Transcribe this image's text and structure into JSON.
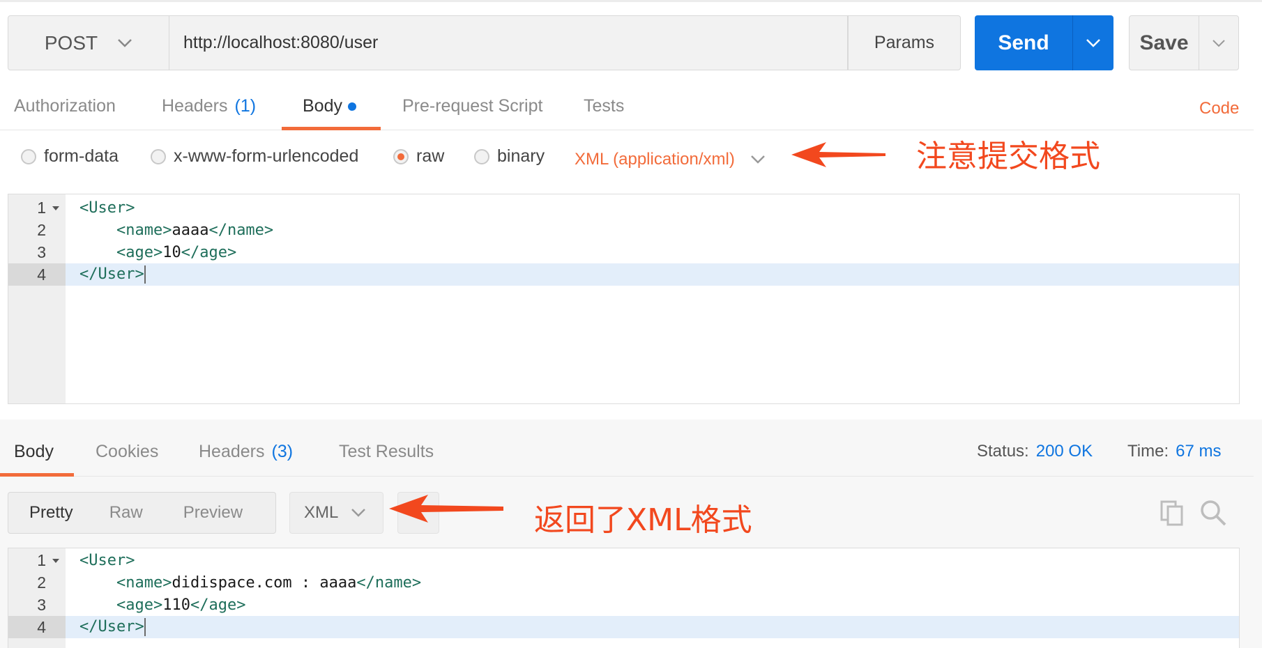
{
  "request": {
    "method": "POST",
    "url": "http://localhost:8080/user",
    "params_label": "Params",
    "send_label": "Send",
    "save_label": "Save"
  },
  "request_tabs": {
    "authorization": "Authorization",
    "headers": "Headers",
    "headers_count": "(1)",
    "body": "Body",
    "prerequest": "Pre-request Script",
    "tests": "Tests",
    "code": "Code"
  },
  "body_options": {
    "form_data": "form-data",
    "urlencoded": "x-www-form-urlencoded",
    "raw": "raw",
    "binary": "binary",
    "selected": "raw",
    "format": "XML (application/xml)"
  },
  "annotations": {
    "request_note": "注意提交格式",
    "response_note": "返回了XML格式"
  },
  "request_body": {
    "line_numbers": [
      "1",
      "2",
      "3",
      "4"
    ],
    "l1_tag": "<User>",
    "l2_open": "<name>",
    "l2_text": "aaaa",
    "l2_close": "</name>",
    "l3_open": "<age>",
    "l3_text": "10",
    "l3_close": "</age>",
    "l4_tag": "</User>"
  },
  "response_tabs": {
    "body": "Body",
    "cookies": "Cookies",
    "headers": "Headers",
    "headers_count": "(3)",
    "test_results": "Test Results"
  },
  "response_status": {
    "status_label": "Status:",
    "status_value": "200 OK",
    "time_label": "Time:",
    "time_value": "67 ms"
  },
  "response_view": {
    "pretty": "Pretty",
    "raw": "Raw",
    "preview": "Preview",
    "format": "XML"
  },
  "response_body": {
    "line_numbers": [
      "1",
      "2",
      "3",
      "4"
    ],
    "l1_tag": "<User>",
    "l2_open": "<name>",
    "l2_text": "didispace.com : aaaa",
    "l2_close": "</name>",
    "l3_open": "<age>",
    "l3_text": "110",
    "l3_close": "</age>",
    "l4_tag": "</User>"
  },
  "colors": {
    "accent_orange": "#f26b3a",
    "send_blue": "#0f75e0",
    "annotation_red": "#f2481e",
    "xml_tag": "#1e6e5a"
  },
  "icons": {
    "method_dropdown": "chevron-down-icon",
    "send_dropdown": "chevron-down-icon",
    "save_dropdown": "chevron-down-icon",
    "format_dropdown": "chevron-down-icon",
    "copy": "copy-icon",
    "search": "search-icon",
    "arrow": "arrow-left-icon"
  }
}
